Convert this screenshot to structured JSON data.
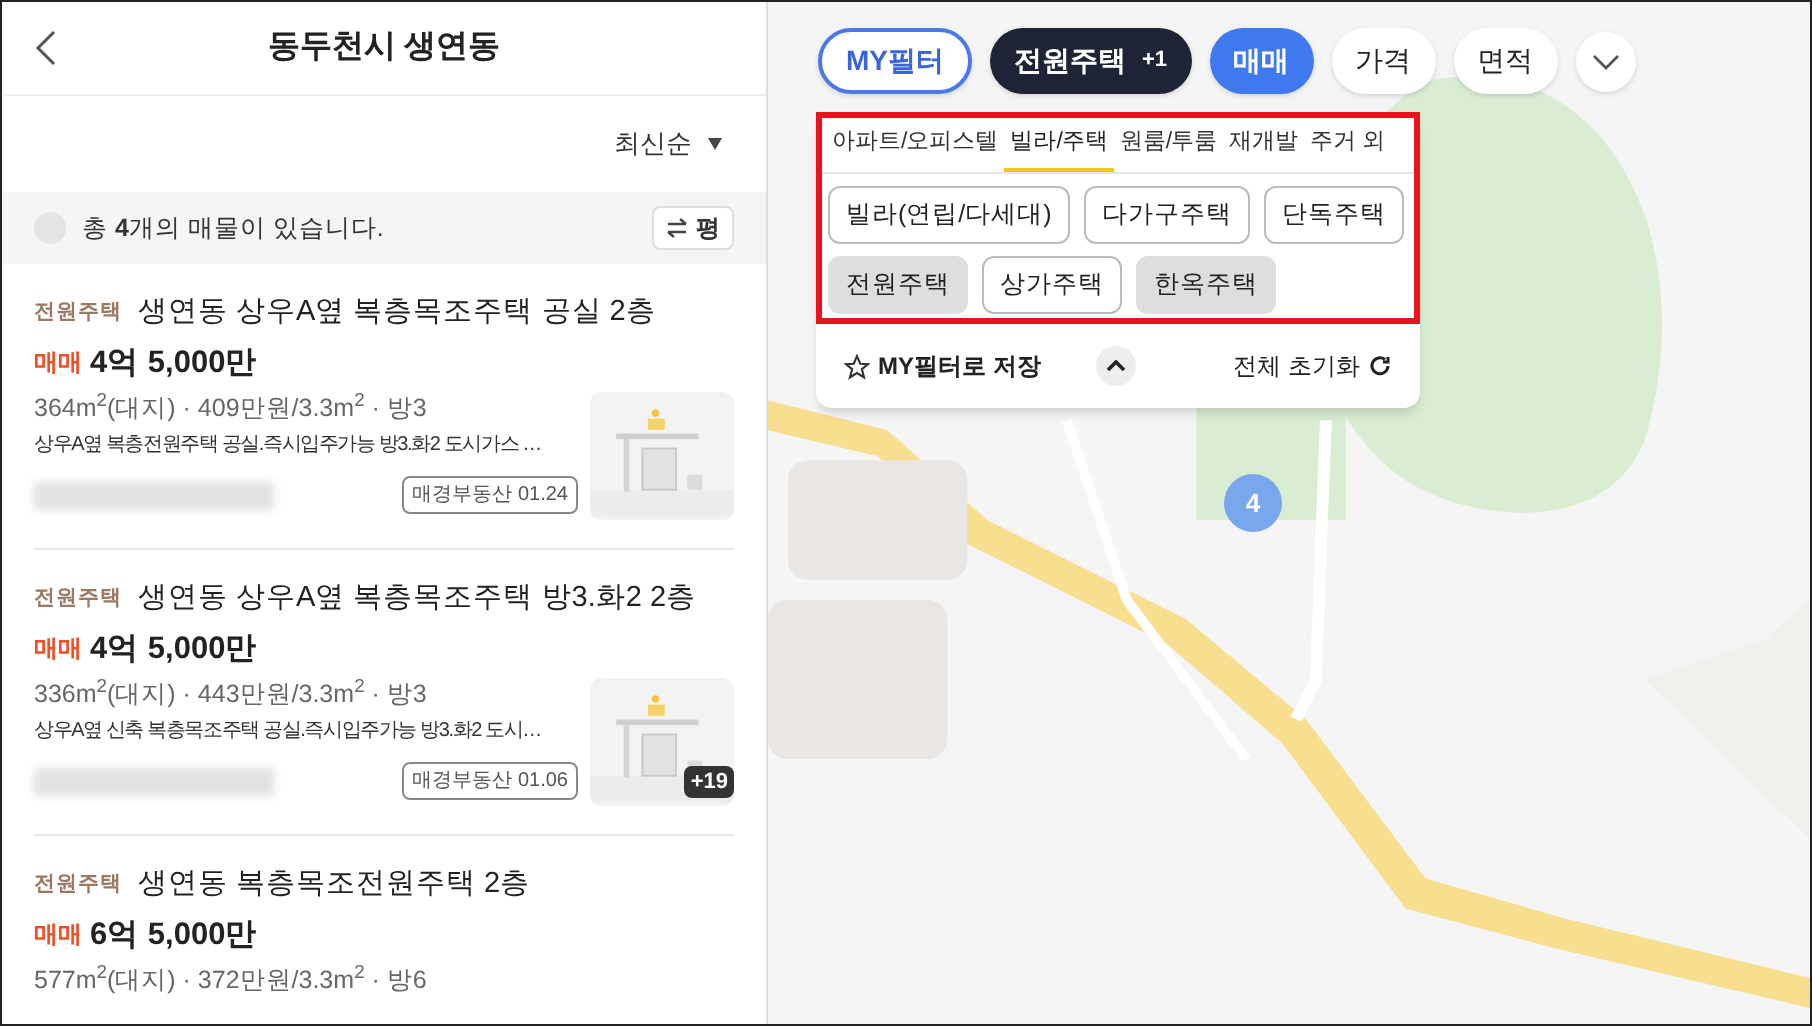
{
  "header": {
    "title": "동두천시 생연동"
  },
  "sort": {
    "label": "최신순"
  },
  "summary": {
    "text": "총 **4**개의 매물이 있습니다.",
    "unit_button": "평"
  },
  "listings": [
    {
      "type": "전원주택",
      "title": "생연동 상우A옆 복층목조주택 공실 2층",
      "deal": "매매",
      "price": "4억 5,000만",
      "specs": "364m$^{2}$(대지) · 409만원/3.3m$^{2}$ · 방3",
      "description": "상우A옆 복층전원주택 공실.즉시입주가능 방3.화2 도시가스 …",
      "agent": "매경부동산 01.24"
    },
    {
      "type": "전원주택",
      "title": "생연동 상우A옆 복층목조주택 방3.화2 2층",
      "deal": "매매",
      "price": "4억 5,000만",
      "specs": "336m$^{2}$(대지) · 443만원/3.3m$^{2}$ · 방3",
      "description": "상우A옆 신축 복층목조주택 공실.즉시입주가능 방3.화2 도시…",
      "agent": "매경부동산 01.06",
      "photo_count": "+19"
    },
    {
      "type": "전원주택",
      "title": "생연동 복층목조전원주택 2층",
      "deal": "매매",
      "price": "6억 5,000만",
      "specs": "577m$^{2}$(대지) · 372만원/3.3m$^{2}$ · 방6"
    }
  ],
  "filter_chips": [
    {
      "label": "MY필터",
      "kind": "outline"
    },
    {
      "label": "전원주택",
      "kind": "dark",
      "badge": "+1"
    },
    {
      "label": "매매",
      "kind": "blue"
    },
    {
      "label": "가격",
      "kind": "plain"
    },
    {
      "label": "면적",
      "kind": "plain"
    }
  ],
  "filter_panel": {
    "tabs": [
      {
        "label": "아파트/오피스텔",
        "selected": false
      },
      {
        "label": "빌라/주택",
        "selected": true
      },
      {
        "label": "원룸/투룸",
        "selected": false
      },
      {
        "label": "재개발",
        "selected": false
      },
      {
        "label": "주거 외",
        "selected": false
      }
    ],
    "options": [
      {
        "label": "빌라(연립/다세대)",
        "selected": false
      },
      {
        "label": "다가구주택",
        "selected": false
      },
      {
        "label": "단독주택",
        "selected": false
      },
      {
        "label": "전원주택",
        "selected": true
      },
      {
        "label": "상가주택",
        "selected": false
      },
      {
        "label": "한옥주택",
        "selected": true
      }
    ],
    "save_label": "MY필터로 저장",
    "reset_label": "전체 초기화"
  },
  "map": {
    "cluster": "4"
  }
}
